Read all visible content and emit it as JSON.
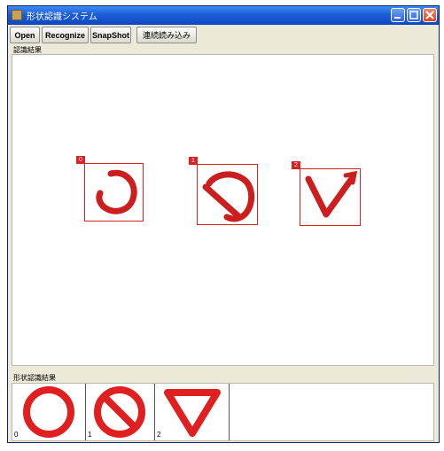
{
  "window": {
    "title": "形状認識システム"
  },
  "toolbar": {
    "buttons": [
      {
        "label": "Open"
      },
      {
        "label": "Recognize"
      },
      {
        "label": "SnapShot"
      },
      {
        "label": "連続読み込み"
      }
    ]
  },
  "canvas": {
    "label": "認識結果",
    "detections": [
      {
        "index": "0",
        "shape": "circle-stroke"
      },
      {
        "index": "1",
        "shape": "no-entry-stroke"
      },
      {
        "index": "2",
        "shape": "v-stroke"
      }
    ]
  },
  "results": {
    "label": "形状認識結果",
    "items": [
      {
        "index": "0",
        "shape": "circle-icon"
      },
      {
        "index": "1",
        "shape": "prohibition-icon"
      },
      {
        "index": "2",
        "shape": "triangle-icon"
      }
    ]
  },
  "colors": {
    "accent": "#e02020",
    "titlebar": "#1c5ed8"
  }
}
